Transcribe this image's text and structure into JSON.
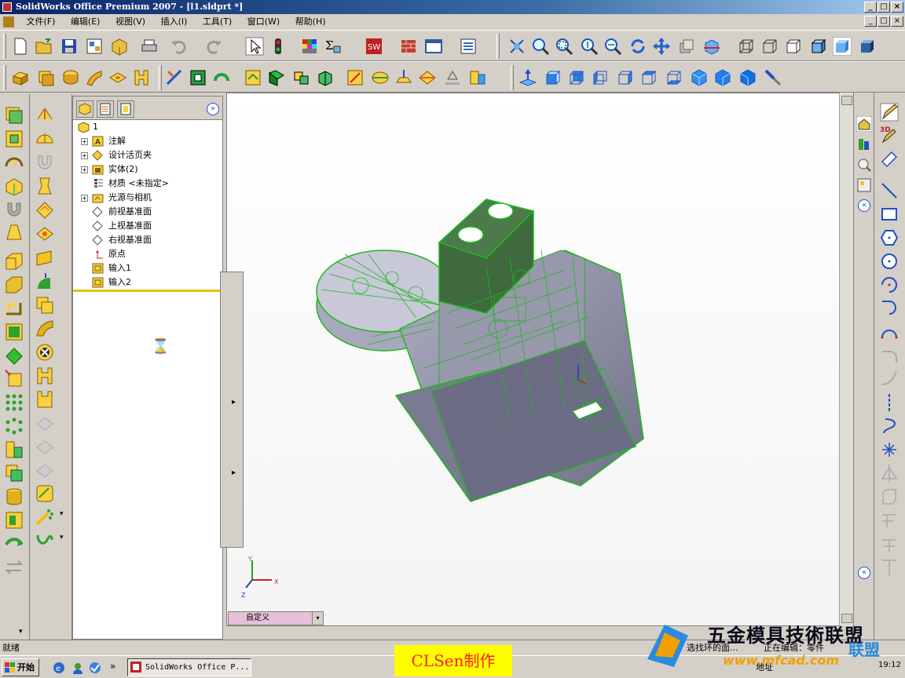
{
  "window": {
    "title": "SolidWorks Office Premium 2007 - [l1.sldprt *]",
    "min": "_",
    "max": "□",
    "close": "×",
    "doc_min": "_",
    "doc_max": "□",
    "doc_close": "×"
  },
  "menu": [
    "文件(F)",
    "编辑(E)",
    "视图(V)",
    "插入(I)",
    "工具(T)",
    "窗口(W)",
    "帮助(H)"
  ],
  "feature_manager": {
    "collapse": "»",
    "root": "1",
    "items": [
      {
        "label": "注解",
        "expandable": true
      },
      {
        "label": "设计活页夹",
        "expandable": true
      },
      {
        "label": "实体(2)",
        "expandable": true
      },
      {
        "label": "材质 <未指定>",
        "expandable": false
      },
      {
        "label": "光源与相机",
        "expandable": true
      },
      {
        "label": "前视基准面",
        "expandable": false
      },
      {
        "label": "上视基准面",
        "expandable": false
      },
      {
        "label": "右视基准面",
        "expandable": false
      },
      {
        "label": "原点",
        "expandable": false
      },
      {
        "label": "输入1",
        "expandable": false
      },
      {
        "label": "输入2",
        "expandable": false
      }
    ],
    "hourglass": "⌛"
  },
  "splitter": {
    "arrow1": "▸",
    "arrow2": "▸"
  },
  "graphics": {
    "triad": {
      "x": "X",
      "y": "Y",
      "z": "Z"
    },
    "view_combo": "自定义",
    "combo_arrow": "▾"
  },
  "task_pane": {
    "collapse": "«",
    "collapse2": "«"
  },
  "status": {
    "left": "就绪",
    "right1": "选找环的面...",
    "right2": "正在编辑：零件"
  },
  "taskbar": {
    "start": "开始",
    "app": "SolidWorks Office P...",
    "more": "»",
    "address": "地址",
    "clock": "19:12"
  },
  "overlay": {
    "author_label": "CLSen制作",
    "watermark": "五金模具技術联盟",
    "watermark_url": "www.mfcad.com",
    "logo_text": "联盟"
  },
  "colors": {
    "accent": "#0a246a",
    "wire": "#1fb81f",
    "body": "#8c8fa5",
    "status_yellow": "#ffff00"
  }
}
